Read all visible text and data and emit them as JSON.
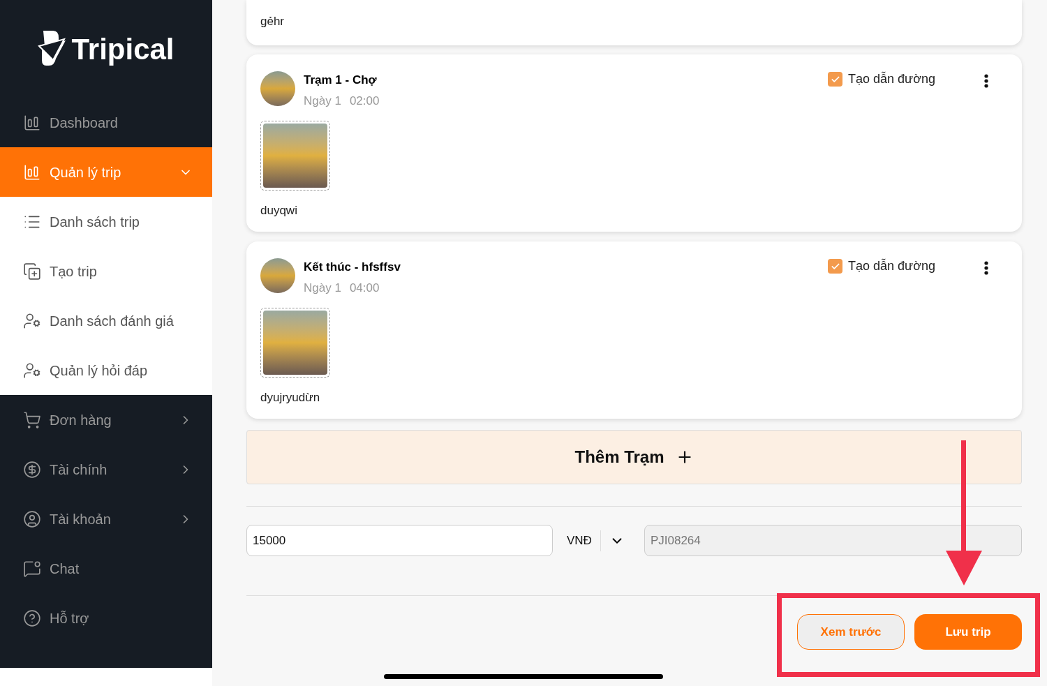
{
  "sidebar": {
    "logo": "Tripical",
    "items": [
      {
        "label": "Dashboard",
        "kind": "main",
        "selected": false
      },
      {
        "label": "Quản lý trip",
        "kind": "main",
        "selected": true,
        "expanded": true
      },
      {
        "label": "Danh sách trip",
        "kind": "sub",
        "selected": false
      },
      {
        "label": "Tạo trip",
        "kind": "sub",
        "selected": false
      },
      {
        "label": "Danh sách đánh giá",
        "kind": "sub",
        "selected": false
      },
      {
        "label": "Quản lý hỏi đáp",
        "kind": "sub",
        "selected": false
      },
      {
        "label": "Đơn hàng",
        "kind": "main",
        "selected": false,
        "expanded": false
      },
      {
        "label": "Tài chính",
        "kind": "main",
        "selected": false,
        "expanded": false
      },
      {
        "label": "Tài khoản",
        "kind": "main",
        "selected": false,
        "expanded": false
      },
      {
        "label": "Chat",
        "kind": "main",
        "selected": false
      },
      {
        "label": "Hỗ trợ",
        "kind": "main",
        "selected": false
      }
    ]
  },
  "partial_card": {
    "caption": "gẻhr"
  },
  "stations": [
    {
      "title": "Trạm 1 - Chợ",
      "day": "Ngày 1",
      "time": "02:00",
      "caption": "duyqwi",
      "directions": {
        "label": "Tạo dẫn đường",
        "checked": true
      }
    },
    {
      "title": "Kết thúc - hfsffsv",
      "day": "Ngày 1",
      "time": "04:00",
      "caption": "dyujryudừn",
      "directions": {
        "label": "Tạo dẫn đường",
        "checked": true
      }
    }
  ],
  "add_station": {
    "label": "Thêm Trạm"
  },
  "price": {
    "value": "15000",
    "currency": "VNĐ"
  },
  "code": {
    "value": "PJI08264"
  },
  "buttons": [
    {
      "label": "Xem trước",
      "kind": "outline"
    },
    {
      "label": "Lưu trip",
      "kind": "primary"
    }
  ]
}
